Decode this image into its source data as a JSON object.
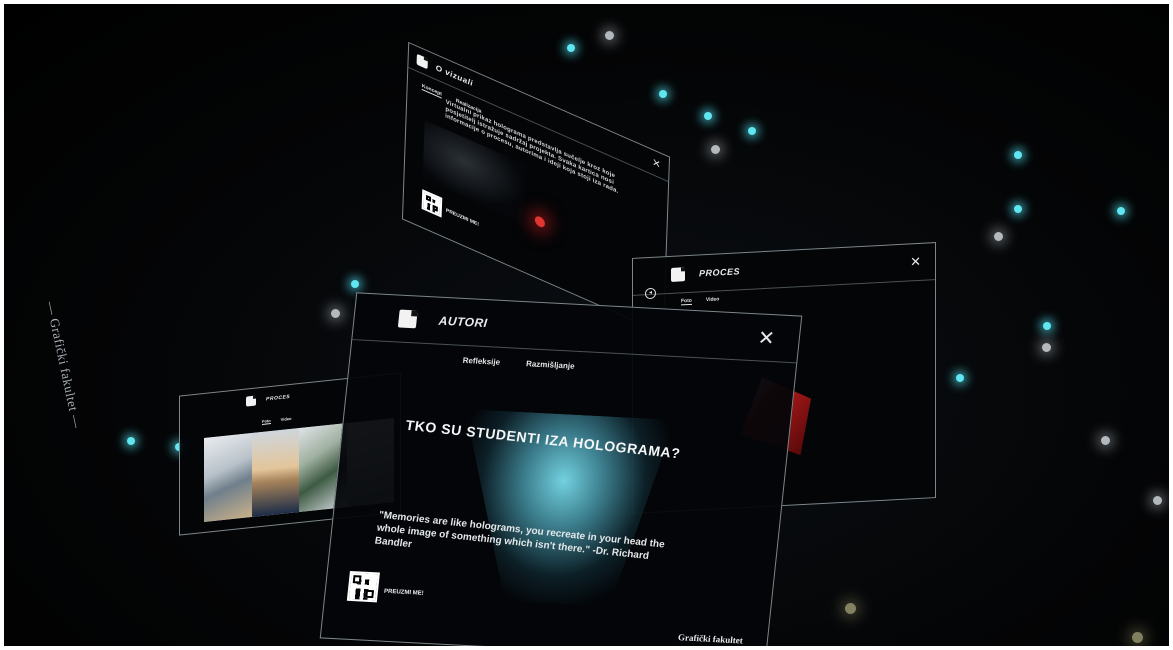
{
  "side_text": "— Grafički fakultet —",
  "panels": {
    "info": {
      "title": "O vizuali",
      "tabs": [
        "Koncept",
        "Realizacija"
      ],
      "body": "Virtualni prikaz holograma predstavlja sučelje kroz koje posjetitelj istražuje sadržaj projekta. Svaka kartica nosi informacije o procesu, autorima i ideji koja stoji iza rada.",
      "qr_label": "PREUZMI ME!"
    },
    "proces_right": {
      "title": "PROCES",
      "tabs": [
        "Foto",
        "Video"
      ]
    },
    "proces_left": {
      "title": "PROCES",
      "tabs": [
        "Foto",
        "Video"
      ]
    },
    "autori": {
      "title": "AUTORI",
      "tabs": [
        "Refleksije",
        "Razmišljanje"
      ],
      "headline": "TKO SU STUDENTI IZA HOLOGRAMA?",
      "quote": "\"Memories are like holograms, you recreate in your head the whole image of something which isn't there.\" -Dr. Richard Bandler",
      "qr_label": "PREUZMI ME!",
      "footer": "Grafički fakultet"
    }
  },
  "colors": {
    "background": "#000000",
    "particle_cyan": "#5fe6f0",
    "particle_white": "#dfe6ea",
    "beam": "#78dceb",
    "red_accent": "#cf1e1e"
  }
}
